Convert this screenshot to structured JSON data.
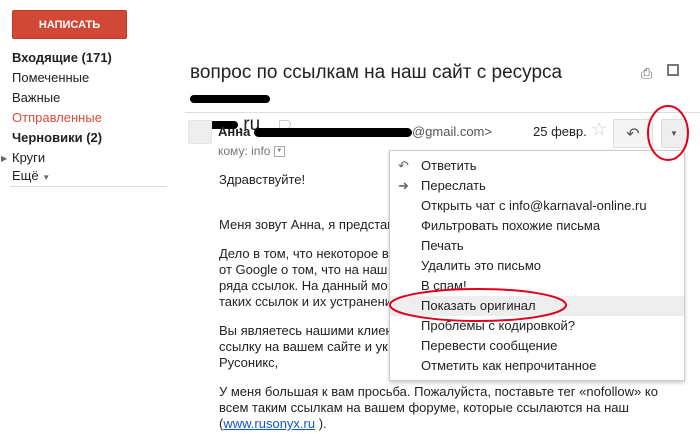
{
  "sidebar": {
    "compose": "НАПИСАТЬ",
    "items": [
      {
        "label": "Входящие (171)"
      },
      {
        "label": "Помеченные"
      },
      {
        "label": "Важные"
      },
      {
        "label": "Отправленные"
      },
      {
        "label": "Черновики (2)"
      },
      {
        "label": "Круги"
      },
      {
        "label": "Ещё"
      }
    ]
  },
  "message": {
    "subject_part1": "вопрос по ссылкам на наш сайт с ресурса",
    "subject_part2": ".ru",
    "sender_name": "Анна",
    "sender_email_tail": "@gmail.com>",
    "date": "25 февр.",
    "to_label": "кому: info",
    "body": [
      "Здравствуйте!",
      "Меня зовут Анна, я представ",
      "Дело в том, что некоторое вр",
      "от Google о том, что на наш",
      "ряда ссылок.  На данный мо",
      "таких ссылок и их устранени",
      "Вы являетесь нашими клиен",
      "ссылку на вашем сайте и ук",
      "Русоникс,",
      "У меня большая к вам просьба. Пожалуйста, поставьте тег «nofollow» ко",
      "всем таким ссылкам на вашем форуме, которые ссылаются на наш"
    ],
    "link": "www.rusonyx.ru",
    "link_tail": " )."
  },
  "menu": {
    "items": [
      {
        "label": "Ответить",
        "icon": "reply-icon"
      },
      {
        "label": "Переслать",
        "icon": "forward-icon"
      },
      {
        "label": "Открыть чат с info@karnaval-online.ru"
      },
      {
        "label": "Фильтровать похожие письма"
      },
      {
        "label": "Печать"
      },
      {
        "label": "Удалить это письмо"
      },
      {
        "label": "В спам!"
      },
      {
        "label": "Показать оригинал",
        "highlighted": true
      },
      {
        "label": "Проблемы с кодировкой?"
      },
      {
        "label": "Перевести сообщение"
      },
      {
        "label": "Отметить как непрочитанное"
      }
    ]
  },
  "colors": {
    "compose": "#d14836",
    "sent": "#dd4b39",
    "annotation": "#e0001a"
  }
}
